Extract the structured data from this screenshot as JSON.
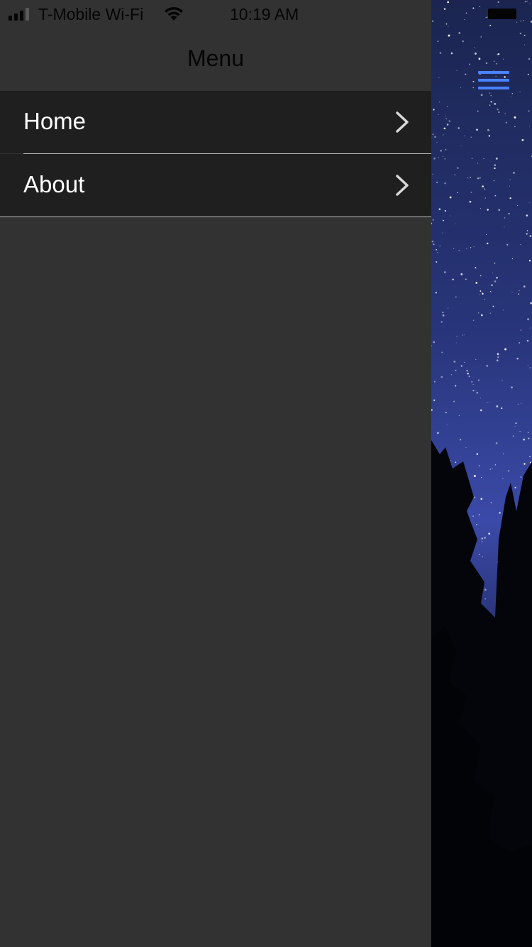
{
  "status_bar": {
    "carrier": "T-Mobile Wi-Fi",
    "time": "10:19 AM",
    "signal_icon": "signal-bars-icon",
    "wifi_icon": "wifi-icon"
  },
  "drawer": {
    "title": "Menu",
    "items": [
      {
        "label": "Home",
        "icon": "chevron-right-icon"
      },
      {
        "label": "About",
        "icon": "chevron-right-icon"
      }
    ]
  },
  "main_view": {
    "menu_button_icon": "hamburger-menu-icon",
    "background": "night-sky-with-trees"
  },
  "colors": {
    "drawer_bg": "#323232",
    "item_bg": "#1f1f1f",
    "accent": "#4a82ff",
    "text": "#ffffff"
  }
}
